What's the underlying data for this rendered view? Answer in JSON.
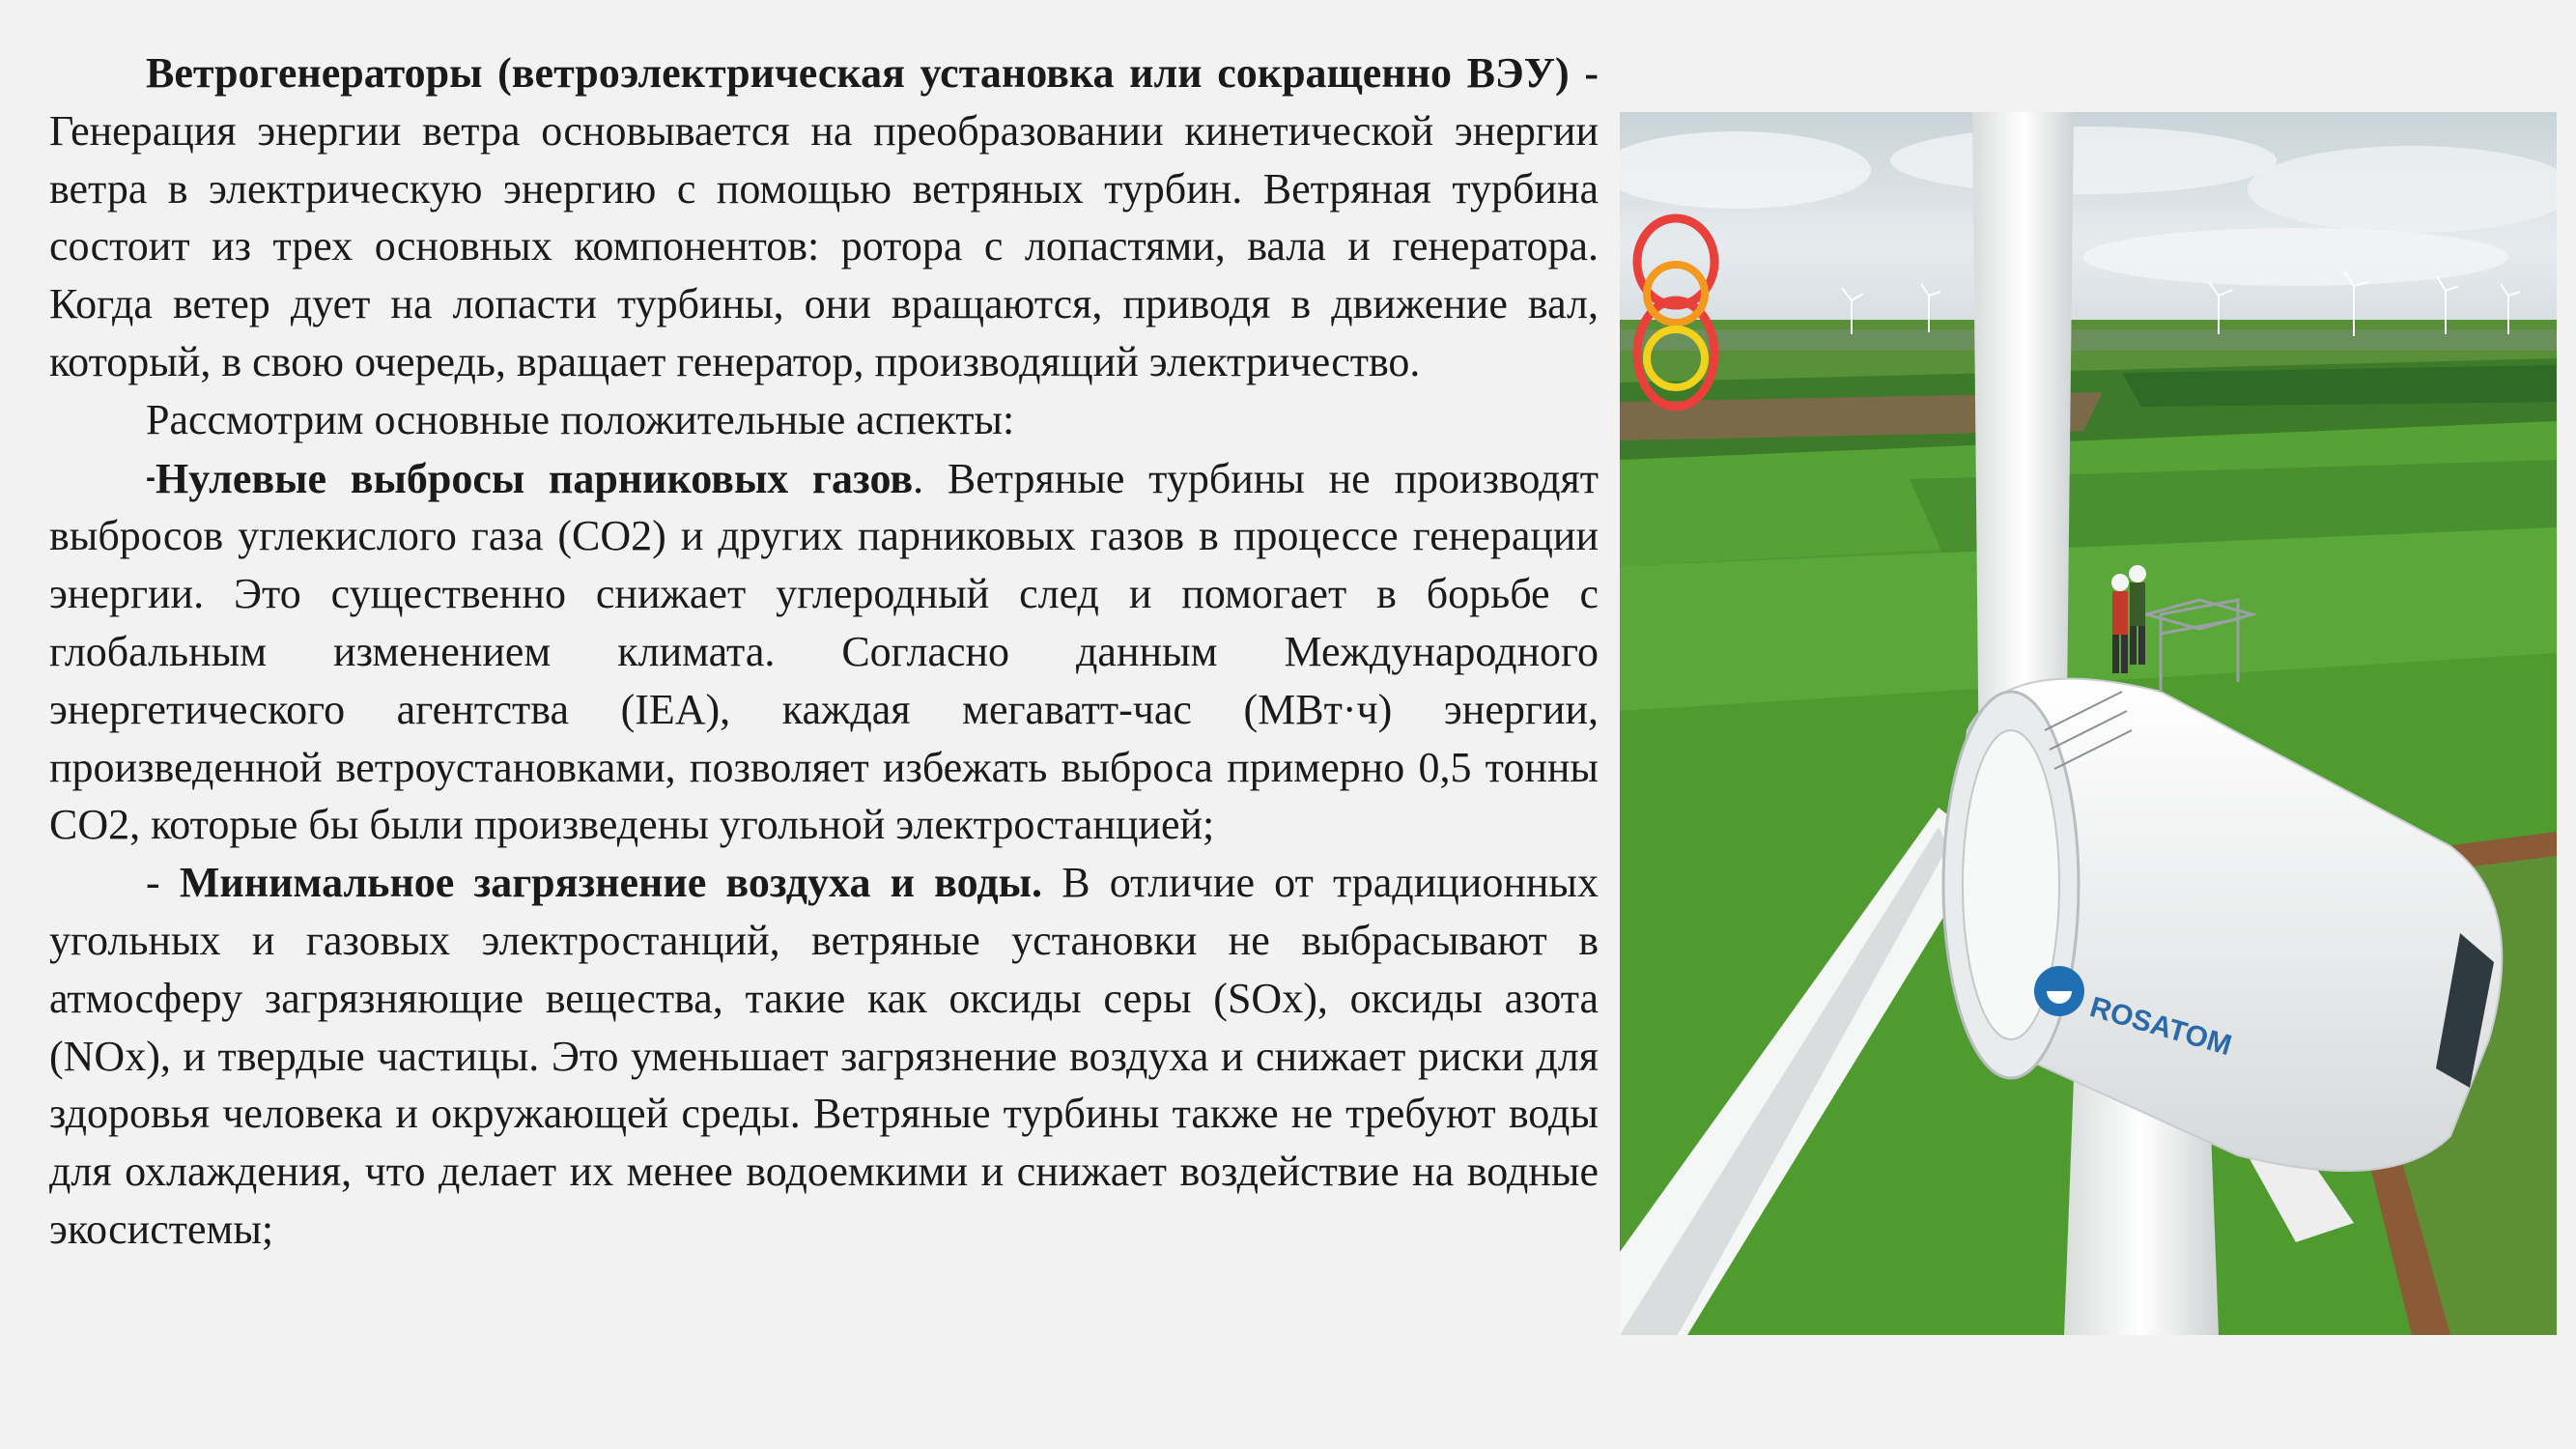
{
  "paragraphs": [
    {
      "bold_lead": "Ветрогенераторы (ветроэлектрическая установка или сокращенно ВЭУ) -",
      "text": " Генерация энергии ветра основывается на преобразовании кинетической энергии ветра в электрическую энергию с помощью ветряных турбин. Ветряная турбина состоит из трех основных компонентов: ротора с лопастями, вала и генератора. Когда ветер дует на лопасти турбины, они вращаются, приводя в движение вал, который, в свою очередь, вращает генератор, производящий электричество."
    },
    {
      "text": "Рассмотрим основные положительные аспекты:"
    },
    {
      "prefix": "-",
      "bold_lead": "Нулевые выбросы парниковых газов",
      "text": ". Ветряные турбины не производят выбросов углекислого газа (CO2) и других парниковых газов в процессе генерации энергии. Это существенно снижает углеродный след и помогает в борьбе с глобальным изменением климата. Согласно данным Международного энергетического агентства (IEA), каждая мегаватт-час (МВт·ч) энергии, произведенной ветроустановками, позволяет избежать выброса примерно 0,5 тонны CO2, которые бы были произведены угольной электростанцией;"
    },
    {
      "prefix": "- ",
      "bold_lead": "Минимальное загрязнение воздуха и воды.",
      "text": " В отличие от традиционных угольных и газовых электростанций, ветряные установки не выбрасывают в атмосферу загрязняющие вещества, такие как оксиды серы (SOx), оксиды азота (NOx), и твердые частицы. Это уменьшает загрязнение воздуха и снижает риски для здоровья человека и окружающей среды. Ветряные турбины также не требуют воды для охлаждения, что делает их менее водоемкими и снижает воздействие на водные экосистемы;"
    }
  ],
  "photo": {
    "brand_text": "ROSATOM",
    "colors": {
      "sky": "#dfe6ea",
      "field": "#4f9a32",
      "nacelle": "#f4f4f4",
      "logo_blue": "#1f6fb2",
      "ring_red": "#e8413c",
      "ring_orange": "#f39a1e",
      "ring_yellow": "#f2d21c"
    }
  }
}
